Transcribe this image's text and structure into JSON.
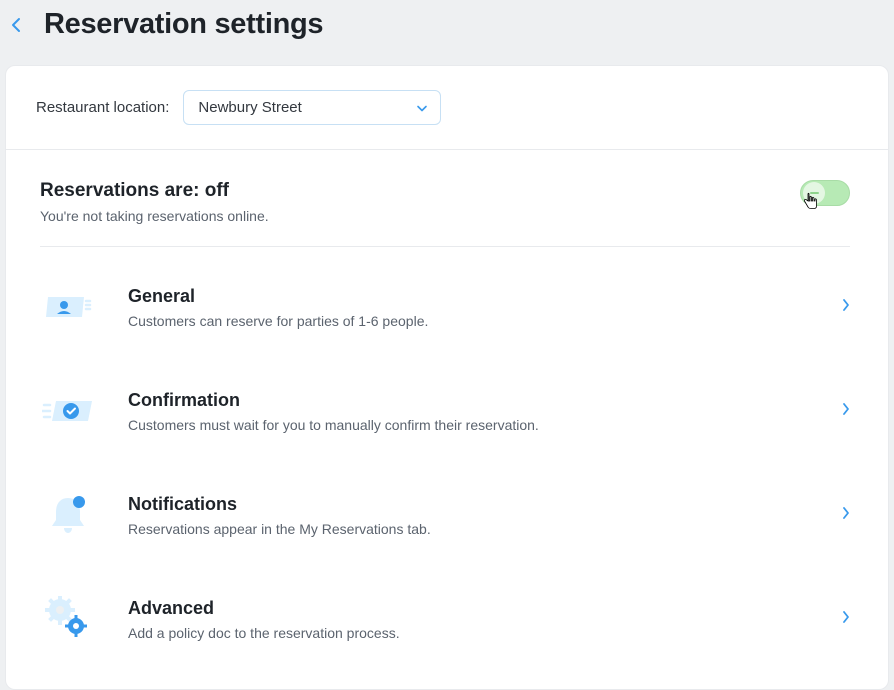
{
  "header": {
    "title": "Reservation settings"
  },
  "location": {
    "label": "Restaurant location:",
    "selected": "Newbury Street"
  },
  "status": {
    "title": "Reservations are: off",
    "subtitle": "You're not taking reservations online."
  },
  "sections": {
    "general": {
      "title": "General",
      "subtitle": "Customers can reserve for parties of 1-6 people."
    },
    "confirmation": {
      "title": "Confirmation",
      "subtitle": "Customers must wait for you to manually confirm their reservation."
    },
    "notifications": {
      "title": "Notifications",
      "subtitle": "Reservations appear in the My Reservations tab."
    },
    "advanced": {
      "title": "Advanced",
      "subtitle": "Add a policy doc to the reservation process."
    }
  }
}
